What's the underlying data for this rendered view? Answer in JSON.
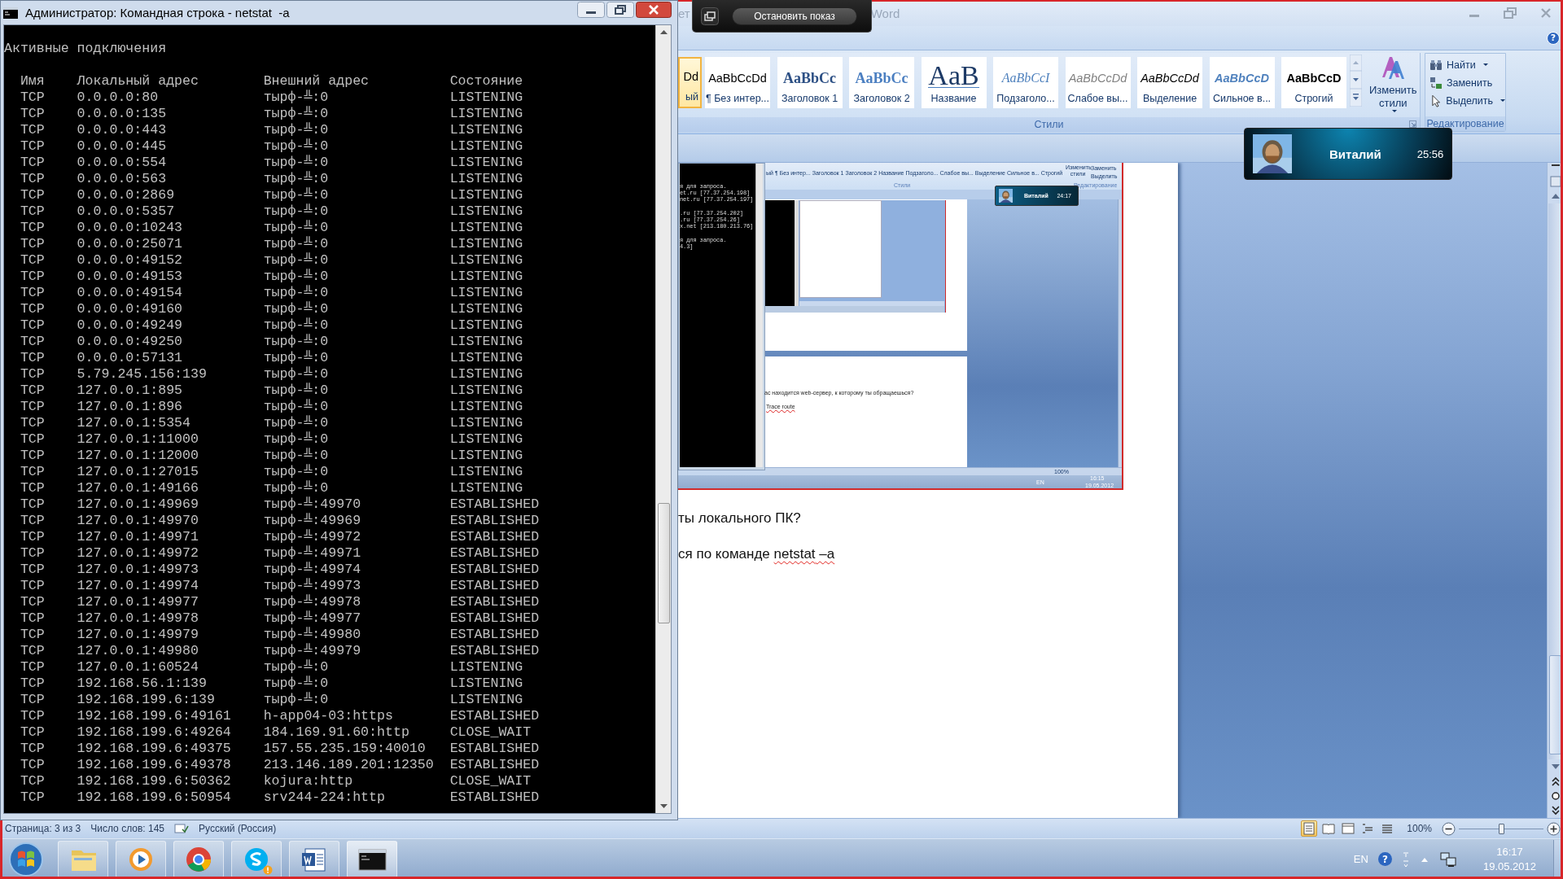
{
  "cmd_window": {
    "title": "Администратор: Командная строка - netstat  -a",
    "heading": "Активные подключения",
    "columns": [
      "Имя",
      "Локальный адрес",
      "Внешний адрес",
      "Состояние"
    ],
    "rows": [
      {
        "proto": "TCP",
        "local": "0.0.0.0:80",
        "foreign": "тырф-╩:0",
        "state": "LISTENING"
      },
      {
        "proto": "TCP",
        "local": "0.0.0.0:135",
        "foreign": "тырф-╩:0",
        "state": "LISTENING"
      },
      {
        "proto": "TCP",
        "local": "0.0.0.0:443",
        "foreign": "тырф-╩:0",
        "state": "LISTENING"
      },
      {
        "proto": "TCP",
        "local": "0.0.0.0:445",
        "foreign": "тырф-╩:0",
        "state": "LISTENING"
      },
      {
        "proto": "TCP",
        "local": "0.0.0.0:554",
        "foreign": "тырф-╩:0",
        "state": "LISTENING"
      },
      {
        "proto": "TCP",
        "local": "0.0.0.0:563",
        "foreign": "тырф-╩:0",
        "state": "LISTENING"
      },
      {
        "proto": "TCP",
        "local": "0.0.0.0:2869",
        "foreign": "тырф-╩:0",
        "state": "LISTENING"
      },
      {
        "proto": "TCP",
        "local": "0.0.0.0:5357",
        "foreign": "тырф-╩:0",
        "state": "LISTENING"
      },
      {
        "proto": "TCP",
        "local": "0.0.0.0:10243",
        "foreign": "тырф-╩:0",
        "state": "LISTENING"
      },
      {
        "proto": "TCP",
        "local": "0.0.0.0:25071",
        "foreign": "тырф-╩:0",
        "state": "LISTENING"
      },
      {
        "proto": "TCP",
        "local": "0.0.0.0:49152",
        "foreign": "тырф-╩:0",
        "state": "LISTENING"
      },
      {
        "proto": "TCP",
        "local": "0.0.0.0:49153",
        "foreign": "тырф-╩:0",
        "state": "LISTENING"
      },
      {
        "proto": "TCP",
        "local": "0.0.0.0:49154",
        "foreign": "тырф-╩:0",
        "state": "LISTENING"
      },
      {
        "proto": "TCP",
        "local": "0.0.0.0:49160",
        "foreign": "тырф-╩:0",
        "state": "LISTENING"
      },
      {
        "proto": "TCP",
        "local": "0.0.0.0:49249",
        "foreign": "тырф-╩:0",
        "state": "LISTENING"
      },
      {
        "proto": "TCP",
        "local": "0.0.0.0:49250",
        "foreign": "тырф-╩:0",
        "state": "LISTENING"
      },
      {
        "proto": "TCP",
        "local": "0.0.0.0:57131",
        "foreign": "тырф-╩:0",
        "state": "LISTENING"
      },
      {
        "proto": "TCP",
        "local": "5.79.245.156:139",
        "foreign": "тырф-╩:0",
        "state": "LISTENING"
      },
      {
        "proto": "TCP",
        "local": "127.0.0.1:895",
        "foreign": "тырф-╩:0",
        "state": "LISTENING"
      },
      {
        "proto": "TCP",
        "local": "127.0.0.1:896",
        "foreign": "тырф-╩:0",
        "state": "LISTENING"
      },
      {
        "proto": "TCP",
        "local": "127.0.0.1:5354",
        "foreign": "тырф-╩:0",
        "state": "LISTENING"
      },
      {
        "proto": "TCP",
        "local": "127.0.0.1:11000",
        "foreign": "тырф-╩:0",
        "state": "LISTENING"
      },
      {
        "proto": "TCP",
        "local": "127.0.0.1:12000",
        "foreign": "тырф-╩:0",
        "state": "LISTENING"
      },
      {
        "proto": "TCP",
        "local": "127.0.0.1:27015",
        "foreign": "тырф-╩:0",
        "state": "LISTENING"
      },
      {
        "proto": "TCP",
        "local": "127.0.0.1:49166",
        "foreign": "тырф-╩:0",
        "state": "LISTENING"
      },
      {
        "proto": "TCP",
        "local": "127.0.0.1:49969",
        "foreign": "тырф-╩:49970",
        "state": "ESTABLISHED"
      },
      {
        "proto": "TCP",
        "local": "127.0.0.1:49970",
        "foreign": "тырф-╩:49969",
        "state": "ESTABLISHED"
      },
      {
        "proto": "TCP",
        "local": "127.0.0.1:49971",
        "foreign": "тырф-╩:49972",
        "state": "ESTABLISHED"
      },
      {
        "proto": "TCP",
        "local": "127.0.0.1:49972",
        "foreign": "тырф-╩:49971",
        "state": "ESTABLISHED"
      },
      {
        "proto": "TCP",
        "local": "127.0.0.1:49973",
        "foreign": "тырф-╩:49974",
        "state": "ESTABLISHED"
      },
      {
        "proto": "TCP",
        "local": "127.0.0.1:49974",
        "foreign": "тырф-╩:49973",
        "state": "ESTABLISHED"
      },
      {
        "proto": "TCP",
        "local": "127.0.0.1:49977",
        "foreign": "тырф-╩:49978",
        "state": "ESTABLISHED"
      },
      {
        "proto": "TCP",
        "local": "127.0.0.1:49978",
        "foreign": "тырф-╩:49977",
        "state": "ESTABLISHED"
      },
      {
        "proto": "TCP",
        "local": "127.0.0.1:49979",
        "foreign": "тырф-╩:49980",
        "state": "ESTABLISHED"
      },
      {
        "proto": "TCP",
        "local": "127.0.0.1:49980",
        "foreign": "тырф-╩:49979",
        "state": "ESTABLISHED"
      },
      {
        "proto": "TCP",
        "local": "127.0.0.1:60524",
        "foreign": "тырф-╩:0",
        "state": "LISTENING"
      },
      {
        "proto": "TCP",
        "local": "192.168.56.1:139",
        "foreign": "тырф-╩:0",
        "state": "LISTENING"
      },
      {
        "proto": "TCP",
        "local": "192.168.199.6:139",
        "foreign": "тырф-╩:0",
        "state": "LISTENING"
      },
      {
        "proto": "TCP",
        "local": "192.168.199.6:49161",
        "foreign": "h-app04-03:https",
        "state": "ESTABLISHED"
      },
      {
        "proto": "TCP",
        "local": "192.168.199.6:49264",
        "foreign": "184.169.91.60:http",
        "state": "CLOSE_WAIT"
      },
      {
        "proto": "TCP",
        "local": "192.168.199.6:49375",
        "foreign": "157.55.235.159:40010",
        "state": "ESTABLISHED"
      },
      {
        "proto": "TCP",
        "local": "192.168.199.6:49378",
        "foreign": "213.146.189.201:12350",
        "state": "ESTABLISHED"
      },
      {
        "proto": "TCP",
        "local": "192.168.199.6:50362",
        "foreign": "kojura:http",
        "state": "CLOSE_WAIT"
      },
      {
        "proto": "TCP",
        "local": "192.168.199.6:50954",
        "foreign": "srv244-224:http",
        "state": "ESTABLISHED"
      }
    ]
  },
  "word_window": {
    "title_parts": [
      "ет",
      "Word"
    ],
    "help": "?",
    "styles": [
      {
        "preview": "Dd",
        "label": "ый",
        "kind": "normal",
        "selected": true
      },
      {
        "preview": "AaBbCcDd",
        "label": "¶ Без интер...",
        "kind": "plain",
        "selected": false
      },
      {
        "preview": "AaBbCc",
        "label": "Заголовок 1",
        "kind": "heading1",
        "selected": false
      },
      {
        "preview": "AaBbCc",
        "label": "Заголовок 2",
        "kind": "heading2",
        "selected": false
      },
      {
        "preview": "AaB",
        "label": "Название",
        "kind": "title",
        "selected": false
      },
      {
        "preview": "AaBbCcI",
        "label": "Подзаголо...",
        "kind": "subtitle",
        "selected": false
      },
      {
        "preview": "AaBbCcDd",
        "label": "Слабое вы...",
        "kind": "subtle",
        "selected": false
      },
      {
        "preview": "AaBbCcDd",
        "label": "Выделение",
        "kind": "emphasis",
        "selected": false
      },
      {
        "preview": "AaBbCcD",
        "label": "Сильное в...",
        "kind": "intense",
        "selected": false
      },
      {
        "preview": "AaBbCcD",
        "label": "Строгий",
        "kind": "strong",
        "selected": false
      }
    ],
    "change_styles": "Изменить стили",
    "styles_group": "Стили",
    "editing": [
      {
        "label": "Найти",
        "kind": "find",
        "dropdown": true
      },
      {
        "label": "Заменить",
        "kind": "replace",
        "dropdown": false
      },
      {
        "label": "Выделить",
        "kind": "select",
        "dropdown": true
      }
    ],
    "editing_group": "Редактирование",
    "document": {
      "screenshot": {
        "console_blocks": [
          [
            "я для запроса.",
            "et.ru [77.37.254.198]",
            "net.ru [77.37.254.197]"
          ],
          [
            ".ru [77.37.254.202]",
            ".ru [77.37.254.26]",
            "x.net [213.180.213.76]"
          ],
          [
            "я для запроса.",
            "4.3]"
          ]
        ],
        "style_labels": [
          "ый",
          "¶ Без интер...",
          "Заголовок 1",
          "Заголовок 2",
          "Название",
          "Подзаголо...",
          "Слабое вы...",
          "Выделение",
          "Сильное в...",
          "Строгий"
        ],
        "change_styles": "Изменить стили",
        "editing": [
          "Заменить",
          "Выделить"
        ],
        "styles_group": "Стили",
        "editing_group": "Редактирование",
        "call": {
          "name": "Виталий",
          "duration": "24:17"
        },
        "question": "ас находится web-сервер, к которому ты обращаешься?",
        "link_text": "Trace route",
        "zoom": "100%",
        "language": "EN",
        "time": "16:15",
        "date": "19.05.2012"
      },
      "paragraphs": [
        [
          {
            "text": "ты локального ПК?",
            "misspelled": false
          }
        ],
        [
          {
            "text": "ся по команде ",
            "misspelled": false
          },
          {
            "text": "netstat",
            "misspelled": true
          },
          {
            "text": " –a",
            "misspelled": true
          }
        ]
      ]
    },
    "status": {
      "left": [
        "Страница: 3 из 3",
        "Число слов: 145",
        "Русский (Россия)"
      ],
      "views": [
        {
          "kind": "print",
          "selected": true
        },
        {
          "kind": "read",
          "selected": false
        },
        {
          "kind": "web",
          "selected": false
        },
        {
          "kind": "outline",
          "selected": false
        },
        {
          "kind": "draft",
          "selected": false
        }
      ],
      "zoom": "100%",
      "zoom_slider": {
        "level": 0.5
      }
    }
  },
  "screen_share_bar": {
    "button": "Остановить показ"
  },
  "call_popup": {
    "name": "Виталий",
    "duration": "25:56"
  },
  "taskbar": {
    "apps": [
      {
        "kind": "start",
        "badge": false
      },
      {
        "kind": "explorer",
        "badge": false
      },
      {
        "kind": "media",
        "badge": false
      },
      {
        "kind": "chrome",
        "badge": false
      },
      {
        "kind": "skype",
        "badge": true
      },
      {
        "kind": "word",
        "badge": false
      },
      {
        "kind": "console",
        "badge": false
      }
    ],
    "tray": {
      "language": "EN",
      "help": "?",
      "time": "16:17",
      "date": "19.05.2012"
    }
  }
}
